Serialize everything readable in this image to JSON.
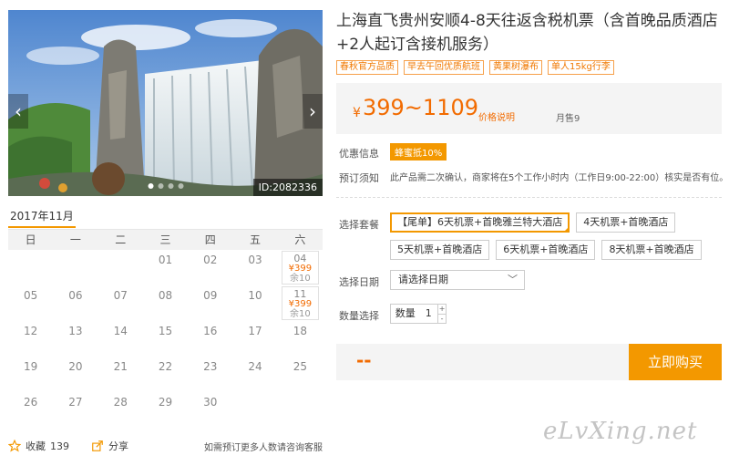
{
  "hero": {
    "id_label": "ID:2082336",
    "prev_glyph": "‹",
    "next_glyph": "›",
    "colors": {
      "sky": "#6f9fd8",
      "rock": "#7d7b73",
      "water": "#e6eef2",
      "grass": "#4f8a3a"
    }
  },
  "product": {
    "title": "上海直飞贵州安顺4-8天往返含税机票（含首晚品质酒店+2人起订含接机服务）",
    "tags": [
      "春秋官方品质",
      "早去午回优质航班",
      "黄果树瀑布",
      "单人15kg行李"
    ]
  },
  "price": {
    "currency": "¥",
    "range": "399~1109",
    "explain": "价格说明",
    "sold": "月售9"
  },
  "promo": {
    "label": "优惠信息",
    "badge": "蜂蜜抵10%"
  },
  "notice": {
    "label": "预订须知",
    "text": "此产品需二次确认，商家将在5个工作小时内（工作日9:00-22:00）核实是否有位。"
  },
  "package": {
    "label": "选择套餐",
    "options": [
      "【尾单】6天机票+首晚雅兰特大酒店",
      "4天机票+首晚酒店",
      "5天机票+首晚酒店",
      "6天机票+首晚酒店",
      "8天机票+首晚酒店"
    ],
    "selected_index": 0
  },
  "date": {
    "label": "选择日期",
    "placeholder": "请选择日期",
    "chevron": "﹀"
  },
  "quantity": {
    "label": "数量选择",
    "field_label": "数量",
    "value": "1",
    "plus": "+",
    "minus": "-"
  },
  "buy": {
    "total": "--",
    "button": "立即购买"
  },
  "calendar": {
    "month": "2017年11月",
    "weekdays": [
      "日",
      "一",
      "二",
      "三",
      "四",
      "五",
      "六"
    ],
    "first_weekday": 3,
    "days_in_month": 30,
    "available": {
      "04": {
        "price": "¥399",
        "remain": "余10"
      },
      "11": {
        "price": "¥399",
        "remain": "余10"
      }
    }
  },
  "footer": {
    "favorite_label": "收藏",
    "favorite_count": "139",
    "share_label": "分享",
    "note": "如需预订更多人数请咨询客服"
  },
  "watermark": "eLvXing.net",
  "accent_color": "#f39800",
  "price_color": "#f26b00"
}
